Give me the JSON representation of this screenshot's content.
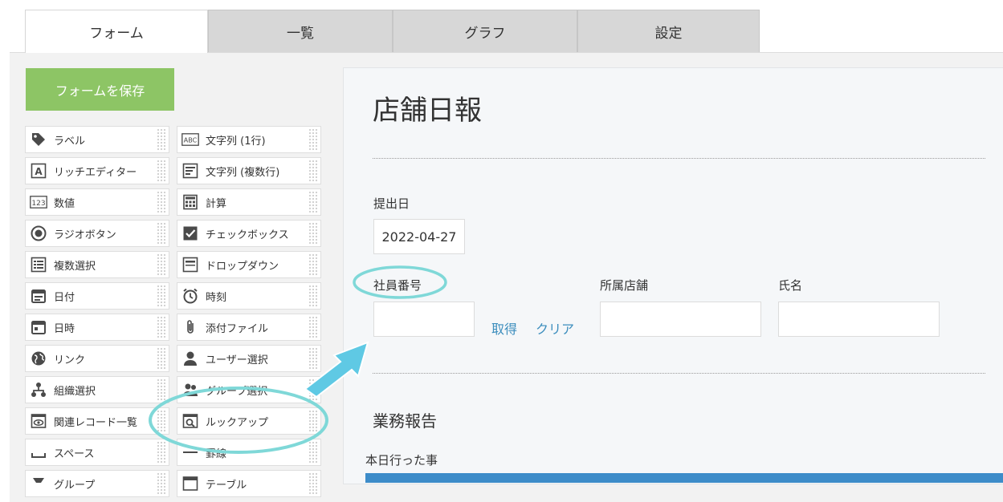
{
  "tabs": [
    {
      "label": "フォーム",
      "active": true
    },
    {
      "label": "一覧",
      "active": false
    },
    {
      "label": "グラフ",
      "active": false
    },
    {
      "label": "設定",
      "active": false
    }
  ],
  "toolbar": {
    "save_label": "フォームを保存"
  },
  "palette": {
    "left": [
      {
        "label": "ラベル",
        "icon": "tag-icon"
      },
      {
        "label": "リッチエディター",
        "icon": "rich-editor-icon"
      },
      {
        "label": "数値",
        "icon": "number-icon"
      },
      {
        "label": "ラジオボタン",
        "icon": "radio-icon"
      },
      {
        "label": "複数選択",
        "icon": "multi-select-icon"
      },
      {
        "label": "日付",
        "icon": "calendar-icon"
      },
      {
        "label": "日時",
        "icon": "datetime-icon"
      },
      {
        "label": "リンク",
        "icon": "globe-icon"
      },
      {
        "label": "組織選択",
        "icon": "organization-icon"
      },
      {
        "label": "関連レコード一覧",
        "icon": "related-records-icon"
      },
      {
        "label": "スペース",
        "icon": "space-icon"
      },
      {
        "label": "グループ",
        "icon": "group-field-icon"
      }
    ],
    "right": [
      {
        "label": "文字列 (1行)",
        "icon": "abc-text-icon"
      },
      {
        "label": "文字列 (複数行)",
        "icon": "multiline-text-icon"
      },
      {
        "label": "計算",
        "icon": "calculator-icon"
      },
      {
        "label": "チェックボックス",
        "icon": "checkbox-icon"
      },
      {
        "label": "ドロップダウン",
        "icon": "dropdown-icon"
      },
      {
        "label": "時刻",
        "icon": "clock-icon"
      },
      {
        "label": "添付ファイル",
        "icon": "paperclip-icon"
      },
      {
        "label": "ユーザー選択",
        "icon": "user-icon"
      },
      {
        "label": "グループ選択",
        "icon": "users-icon"
      },
      {
        "label": "ルックアップ",
        "icon": "lookup-icon"
      },
      {
        "label": "罫線",
        "icon": "line-icon"
      },
      {
        "label": "テーブル",
        "icon": "table-icon"
      }
    ]
  },
  "form": {
    "title": "店舗日報",
    "submit_date": {
      "label": "提出日",
      "value": "2022-04-27"
    },
    "employee_no": {
      "label": "社員番号",
      "value": ""
    },
    "fetch_label": "取得",
    "clear_label": "クリア",
    "store": {
      "label": "所属店舗",
      "value": ""
    },
    "name": {
      "label": "氏名",
      "value": ""
    },
    "section_title": "業務報告",
    "today_label": "本日行った事"
  },
  "colors": {
    "save_button": "#8dc565",
    "highlight": "#7fd8d8",
    "link": "#3b8dbd",
    "accent_bar": "#3d8cc9",
    "tab_inactive": "#d7d7d7"
  }
}
